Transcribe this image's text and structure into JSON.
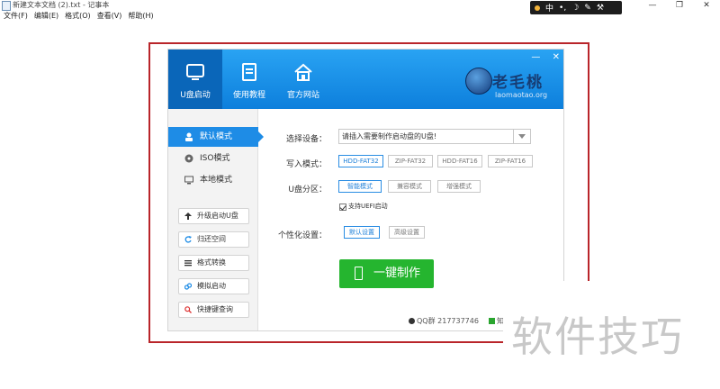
{
  "window": {
    "title": "新建文本文档 (2).txt - 记事本",
    "controls": [
      "—",
      "❐",
      "✕"
    ]
  },
  "menu": [
    "文件(F)",
    "编辑(E)",
    "格式(O)",
    "查看(V)",
    "帮助(H)"
  ],
  "ime": {
    "lang": "中",
    "icons": [
      "•,",
      "☽",
      "✎",
      "⚒"
    ]
  },
  "app": {
    "header_controls": [
      "—",
      "✕"
    ],
    "nav": [
      {
        "label": "U盘启动",
        "icon": "monitor-icon",
        "active": true
      },
      {
        "label": "使用教程",
        "icon": "document-icon",
        "active": false
      },
      {
        "label": "官方网站",
        "icon": "home-icon",
        "active": false
      }
    ],
    "logo": {
      "brand": "老毛桃",
      "site": "laomaotao.org"
    },
    "modes": [
      {
        "label": "默认模式",
        "icon": "user-icon",
        "active": true
      },
      {
        "label": "ISO模式",
        "icon": "disc-icon",
        "active": false
      },
      {
        "label": "本地模式",
        "icon": "monitor-icon",
        "active": false
      }
    ],
    "tools": [
      {
        "label": "升级启动U盘",
        "icon": "upload-icon"
      },
      {
        "label": "归还空间",
        "icon": "refresh-icon"
      },
      {
        "label": "格式转换",
        "icon": "convert-icon"
      },
      {
        "label": "模拟启动",
        "icon": "link-icon"
      },
      {
        "label": "快捷键查询",
        "icon": "search-icon"
      }
    ],
    "form": {
      "device_label": "选择设备：",
      "device_value": "请插入需要制作启动盘的U盘!",
      "write_label": "写入模式：",
      "write_options": [
        "HDD-FAT32",
        "ZIP-FAT32",
        "HDD-FAT16",
        "ZIP-FAT16"
      ],
      "write_selected": 0,
      "partition_label": "U盘分区：",
      "partition_options": [
        "智能模式",
        "兼容模式",
        "增强模式"
      ],
      "partition_selected": 0,
      "uefi_label": "支持UEFI启动",
      "uefi_checked": true,
      "custom_label": "个性化设置：",
      "custom_options": [
        "默认设置",
        "高级设置"
      ],
      "custom_selected": 0,
      "make_button": "一键制作"
    },
    "footer": {
      "qq": "QQ群 217737746",
      "qq2": "知"
    }
  },
  "watermark": "软件技巧",
  "colors": {
    "header": "#1e8ce6",
    "accent": "#1e8ce6",
    "button": "#25b52f",
    "frame": "#b9252a"
  }
}
